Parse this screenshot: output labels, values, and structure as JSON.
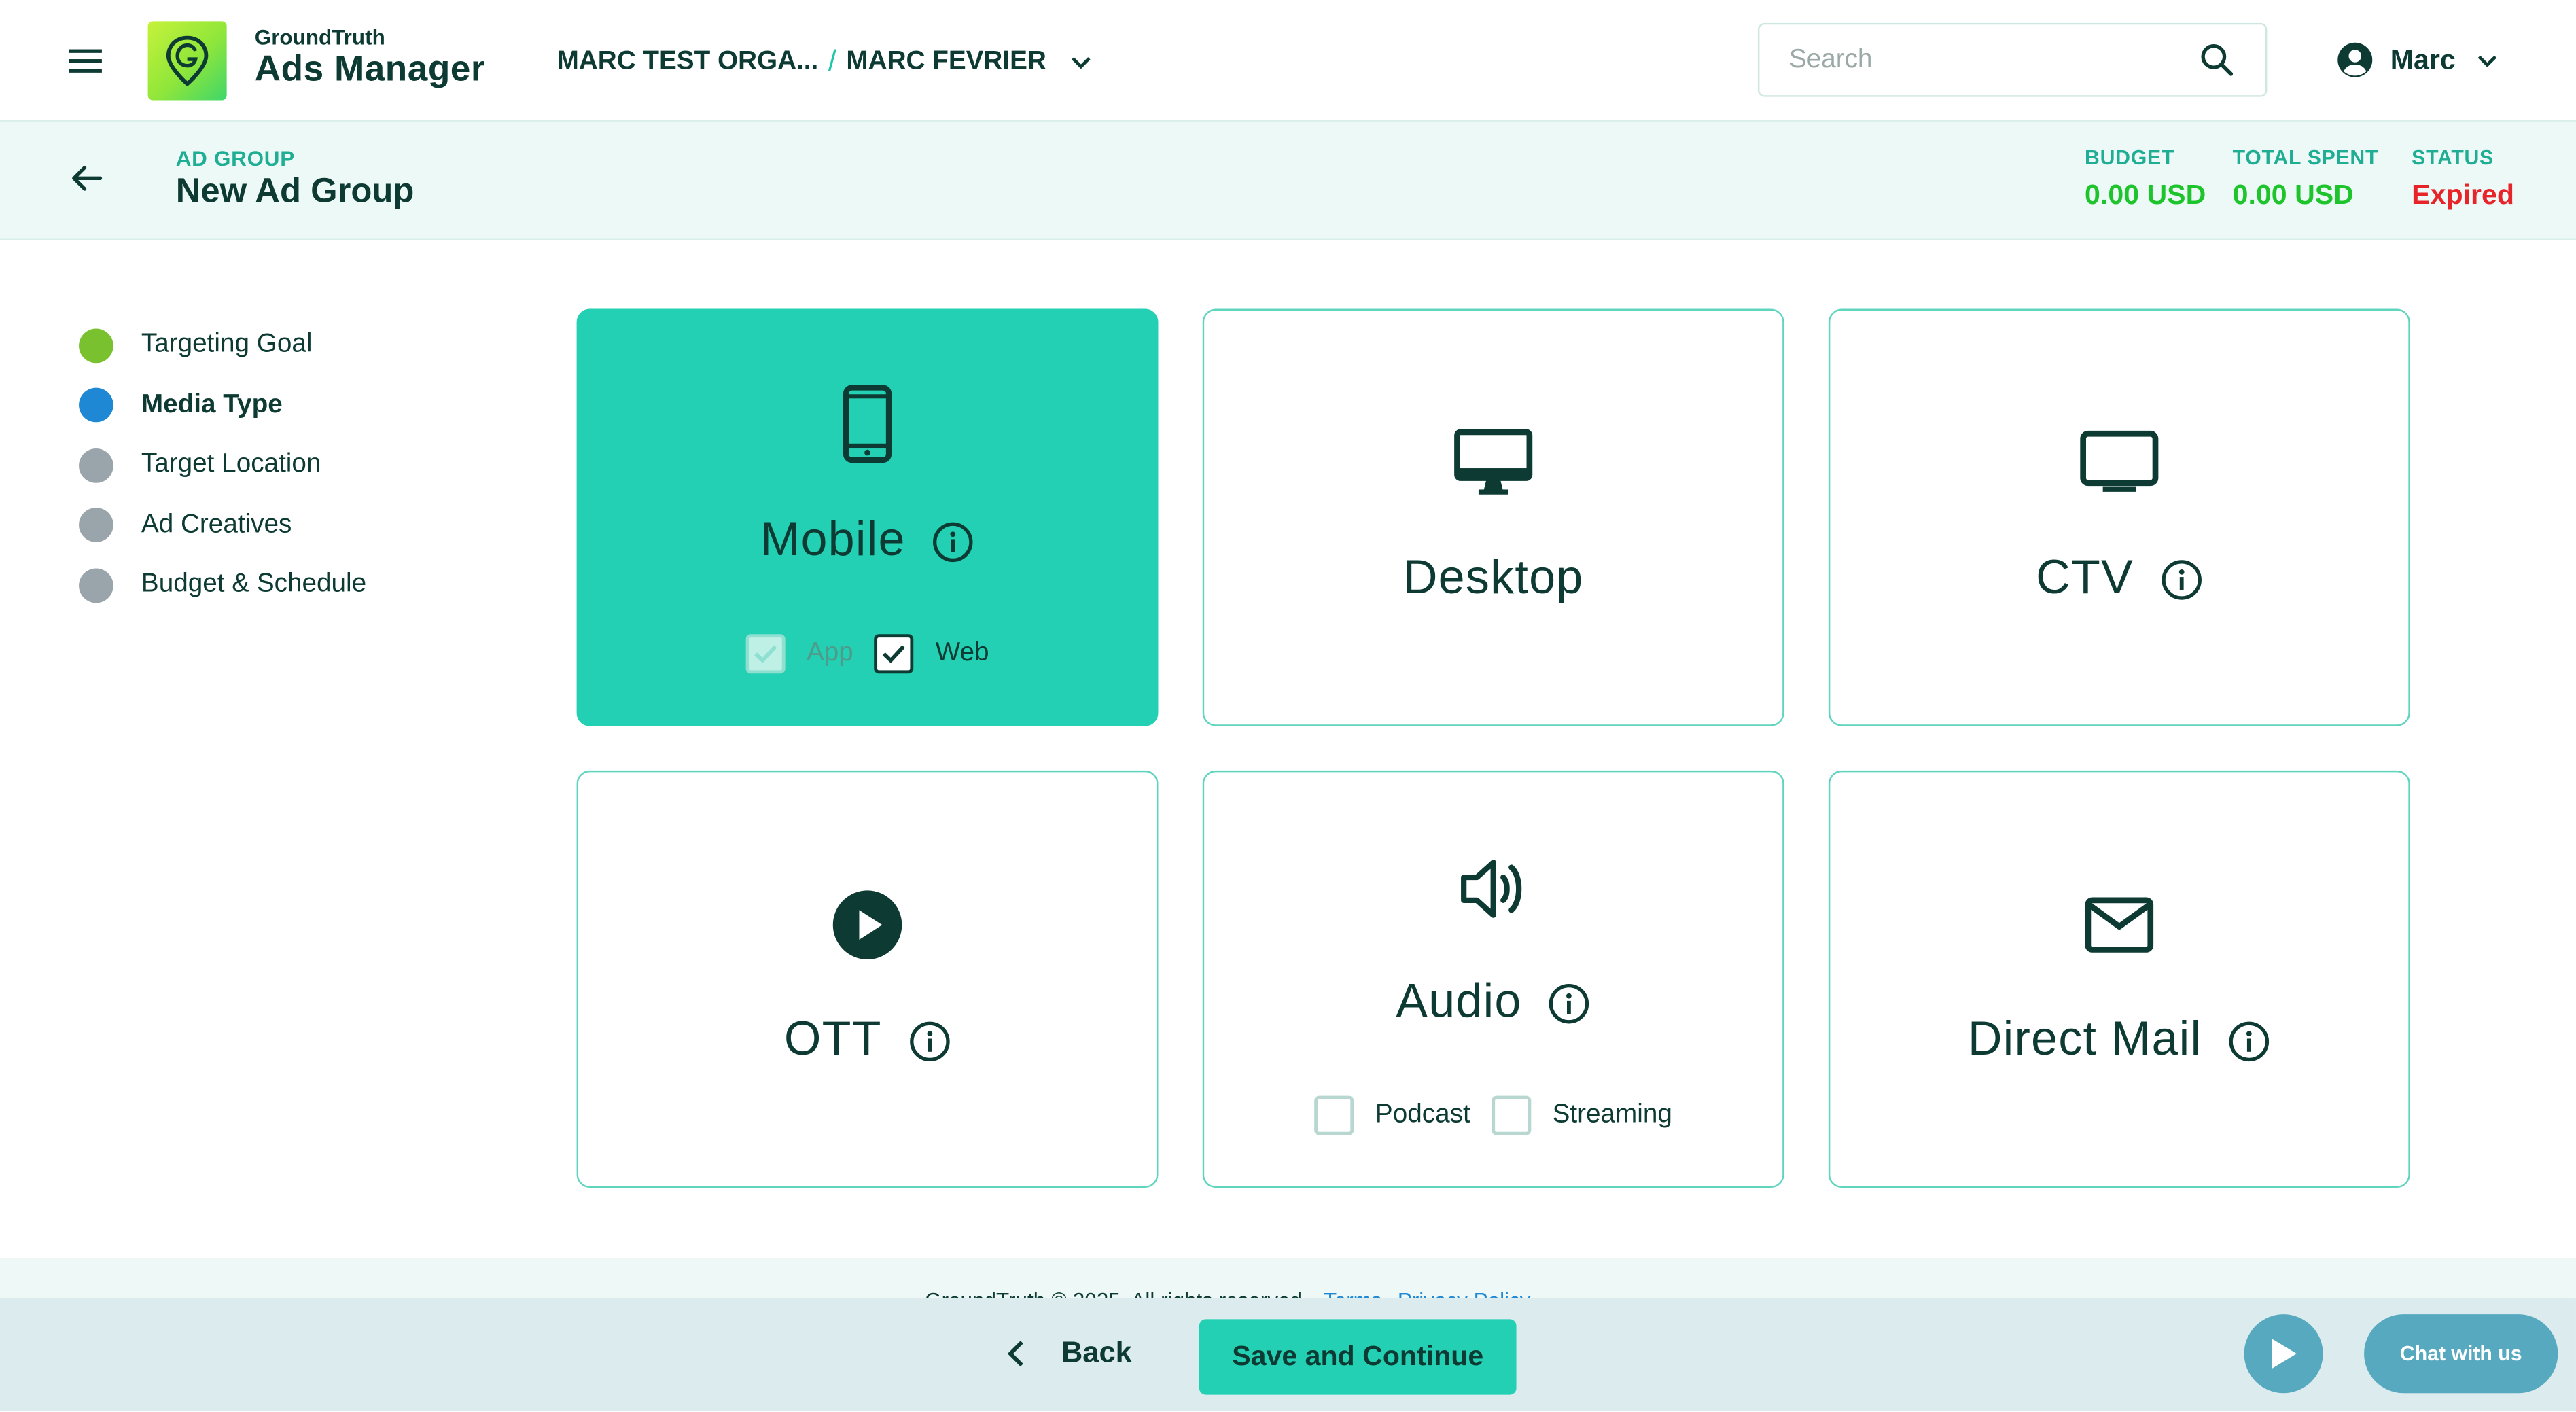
{
  "header": {
    "brand_small": "GroundTruth",
    "brand_big": "Ads Manager",
    "org_name": "MARC TEST ORGA...",
    "org_separator": "/",
    "account_name": "MARC FEVRIER",
    "search_placeholder": "Search",
    "search_value": "",
    "user_name": "Marc"
  },
  "subheader": {
    "label": "AD GROUP",
    "title": "New Ad Group",
    "stats": [
      {
        "label": "BUDGET",
        "value": "0.00 USD"
      },
      {
        "label": "TOTAL SPENT",
        "value": "0.00 USD"
      },
      {
        "label": "STATUS",
        "value": "Expired"
      }
    ]
  },
  "steps": [
    {
      "label": "Targeting Goal",
      "state": "done"
    },
    {
      "label": "Media Type",
      "state": "active"
    },
    {
      "label": "Target Location",
      "state": "pending"
    },
    {
      "label": "Ad Creatives",
      "state": "pending"
    },
    {
      "label": "Budget & Schedule",
      "state": "pending"
    }
  ],
  "media_types": {
    "mobile": {
      "title": "Mobile",
      "icon": "smartphone-icon",
      "selected": true,
      "options": [
        {
          "label": "App",
          "checked": true,
          "disabled": true
        },
        {
          "label": "Web",
          "checked": true,
          "disabled": false
        }
      ]
    },
    "desktop": {
      "title": "Desktop",
      "icon": "desktop-monitor-icon",
      "selected": false
    },
    "ctv": {
      "title": "CTV",
      "icon": "tv-icon",
      "selected": false
    },
    "ott": {
      "title": "OTT",
      "icon": "play-circle-icon",
      "selected": false
    },
    "audio": {
      "title": "Audio",
      "icon": "speaker-icon",
      "selected": false,
      "options": [
        {
          "label": "Podcast",
          "checked": false
        },
        {
          "label": "Streaming",
          "checked": false
        }
      ]
    },
    "direct_mail": {
      "title": "Direct Mail",
      "icon": "mail-envelope-icon",
      "selected": false
    }
  },
  "footer": {
    "copyright": "GroundTruth © 2025. All rights reserved.",
    "terms": "Terms",
    "privacy": "Privacy Policy"
  },
  "actions": {
    "back_label": "Back",
    "save_label": "Save and Continue",
    "chat_label": "Chat with us"
  },
  "colors": {
    "accent": "#23d0b3",
    "dark": "#0d3b33",
    "status_expired": "#e8242b",
    "money_green": "#1ec42b",
    "step_done": "#7ac12f",
    "step_active": "#1e88d4"
  }
}
